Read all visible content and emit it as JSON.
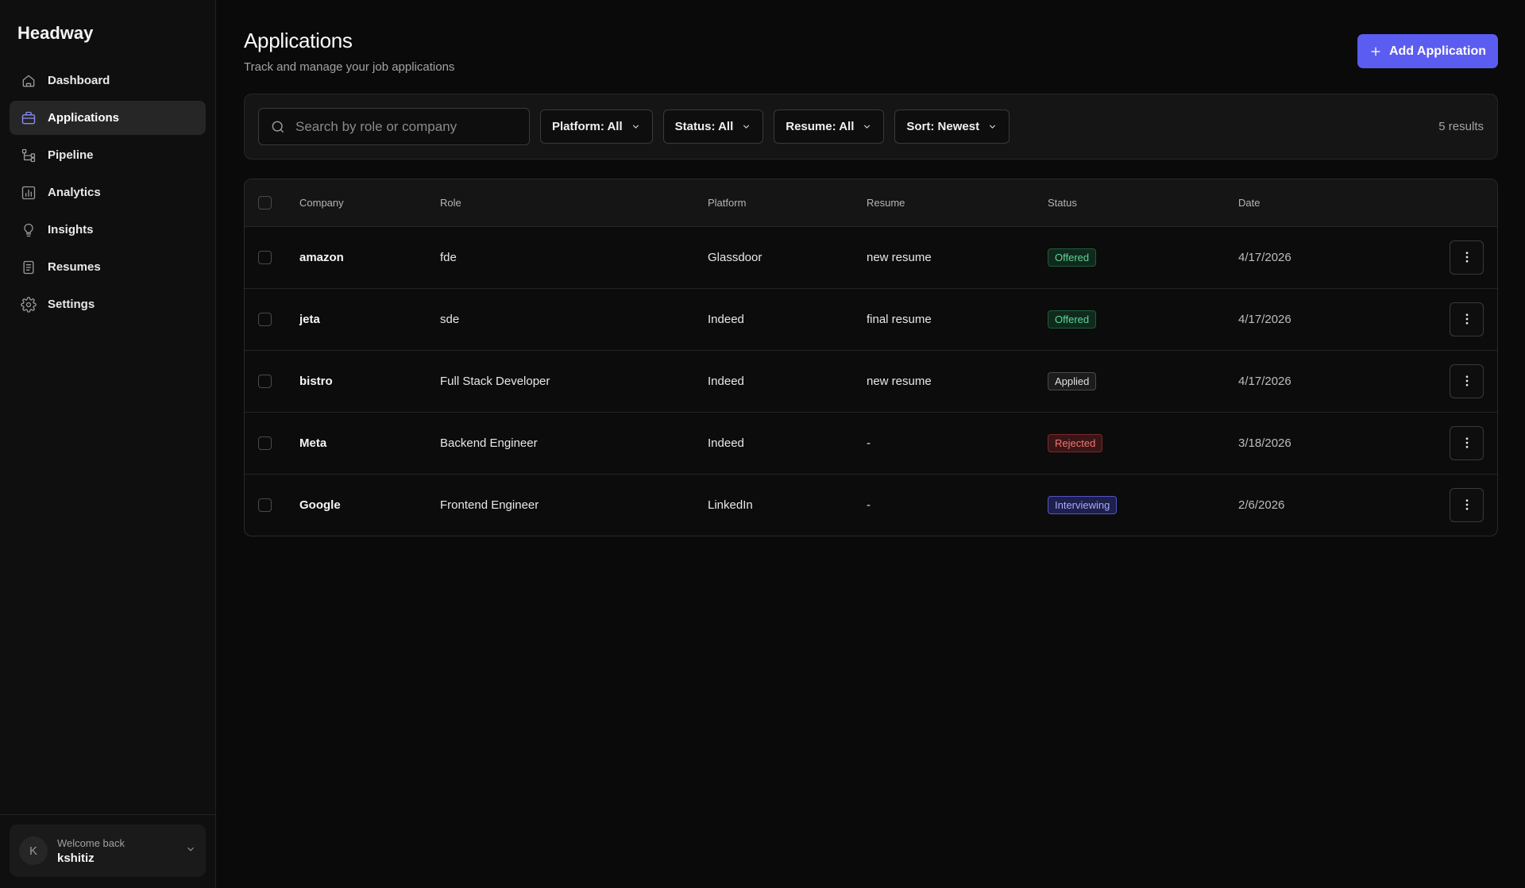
{
  "brand": "Headway",
  "sidebar": {
    "items": [
      {
        "label": "Dashboard",
        "icon": "home-icon",
        "active": false
      },
      {
        "label": "Applications",
        "icon": "briefcase-icon",
        "active": true
      },
      {
        "label": "Pipeline",
        "icon": "pipeline-icon",
        "active": false
      },
      {
        "label": "Analytics",
        "icon": "chart-icon",
        "active": false
      },
      {
        "label": "Insights",
        "icon": "lightbulb-icon",
        "active": false
      },
      {
        "label": "Resumes",
        "icon": "document-icon",
        "active": false
      },
      {
        "label": "Settings",
        "icon": "gear-icon",
        "active": false
      }
    ],
    "user": {
      "initial": "K",
      "welcome": "Welcome back",
      "name": "kshitiz"
    }
  },
  "header": {
    "title": "Applications",
    "subtitle": "Track and manage your job applications",
    "add_label": "Add Application"
  },
  "filters": {
    "search_placeholder": "Search by role or company",
    "search_value": "",
    "platform": "Platform: All",
    "status": "Status: All",
    "resume": "Resume: All",
    "sort": "Sort: Newest",
    "results": "5 results"
  },
  "table": {
    "columns": [
      "Company",
      "Role",
      "Platform",
      "Resume",
      "Status",
      "Date"
    ],
    "rows": [
      {
        "company": "amazon",
        "role": "fde",
        "platform": "Glassdoor",
        "resume": "new resume",
        "status": "Offered",
        "status_key": "offered",
        "date": "4/17/2026"
      },
      {
        "company": "jeta",
        "role": "sde",
        "platform": "Indeed",
        "resume": "final resume",
        "status": "Offered",
        "status_key": "offered",
        "date": "4/17/2026"
      },
      {
        "company": "bistro",
        "role": "Full Stack Developer",
        "platform": "Indeed",
        "resume": "new resume",
        "status": "Applied",
        "status_key": "applied",
        "date": "4/17/2026"
      },
      {
        "company": "Meta",
        "role": "Backend Engineer",
        "platform": "Indeed",
        "resume": "-",
        "status": "Rejected",
        "status_key": "rejected",
        "date": "3/18/2026"
      },
      {
        "company": "Google",
        "role": "Frontend Engineer",
        "platform": "LinkedIn",
        "resume": "-",
        "status": "Interviewing",
        "status_key": "interviewing",
        "date": "2/6/2026"
      }
    ]
  },
  "colors": {
    "accent": "#5b5cf0",
    "offered": "#5fd39a",
    "rejected": "#f07575",
    "interviewing": "#a8a9ff"
  }
}
